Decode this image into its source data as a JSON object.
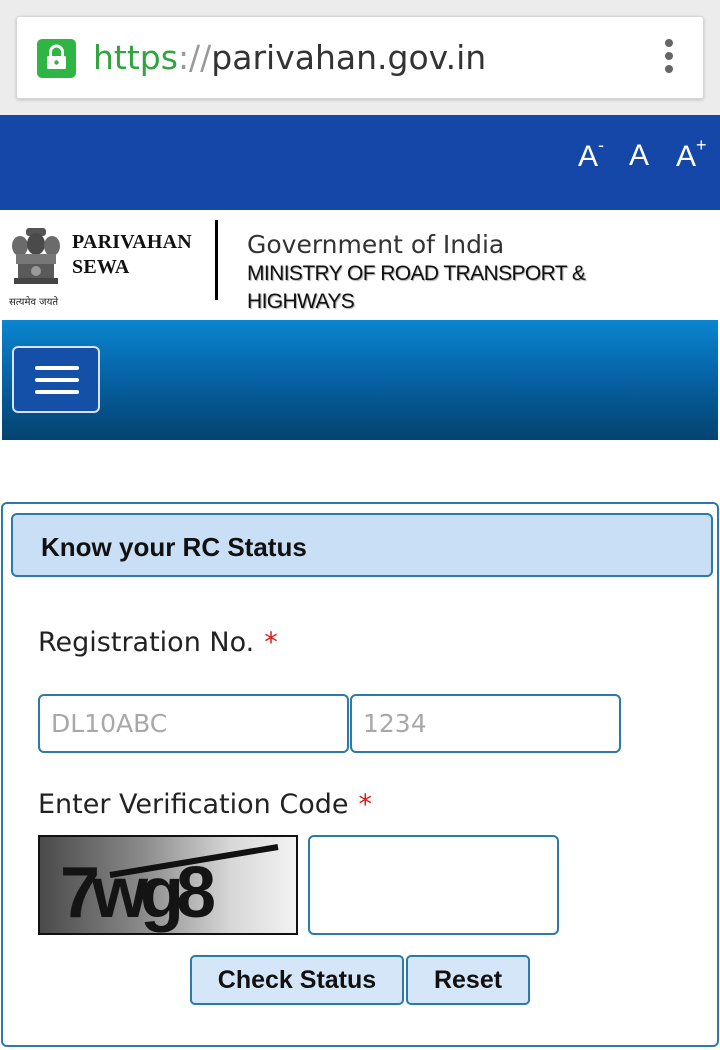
{
  "browser": {
    "url_scheme": "https",
    "url_separator": "://",
    "url_host": "parivahan.gov.in",
    "lock_icon": "lock-icon",
    "menu_icon": "more-vert-icon",
    "lock_color": "#2fb544"
  },
  "top_bar": {
    "font_decrease": "A",
    "font_decrease_sup": "-",
    "font_normal": "A",
    "font_increase": "A",
    "font_increase_sup": "+",
    "color": "#1547a8"
  },
  "header": {
    "brand_line1": "PARIVAHAN",
    "brand_line2": "SEWA",
    "emblem_caption": "सत्यमेव जयते",
    "gov_title": "Government of India",
    "ministry": "MINISTRY OF ROAD TRANSPORT & HIGHWAYS"
  },
  "nav": {
    "menu_icon": "hamburger-icon"
  },
  "form": {
    "title": "Know your RC Status",
    "registration_label": "Registration No.",
    "required_mark": "*",
    "reg_part1_placeholder": "DL10ABC",
    "reg_part2_placeholder": "1234",
    "verification_label": "Enter Verification Code",
    "captcha_text": "7wg8",
    "check_button": "Check Status",
    "reset_button": "Reset",
    "accent_color": "#2a7aaa",
    "header_color": "#c8dff6"
  }
}
